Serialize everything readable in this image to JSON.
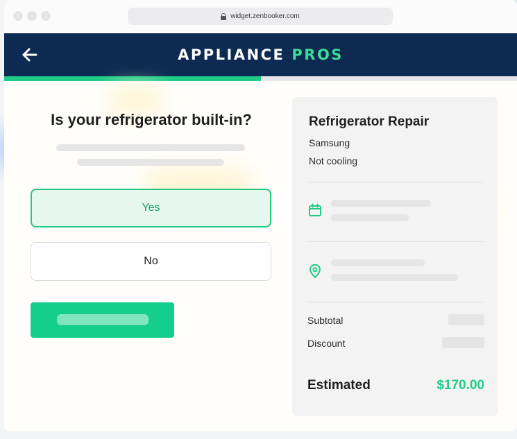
{
  "browser": {
    "url": "widget.zenbooker.com",
    "lock_icon": "lock-icon"
  },
  "header": {
    "back_icon": "arrow-left-icon",
    "brand_primary": "APPLIANCE",
    "brand_accent": "PROS",
    "background_color": "#0d2b52",
    "accent_color": "#3ddc97",
    "progress_fraction": 0.5
  },
  "question": {
    "title": "Is your refrigerator built-in?",
    "options": [
      {
        "label": "Yes",
        "selected": true
      },
      {
        "label": "No",
        "selected": false
      }
    ]
  },
  "summary": {
    "service_title": "Refrigerator Repair",
    "brand": "Samsung",
    "issue": "Not cooling",
    "date_icon": "calendar-icon",
    "location_icon": "map-pin-icon",
    "subtotal_label": "Subtotal",
    "discount_label": "Discount",
    "estimated_label": "Estimated",
    "estimated_value": "$170.00"
  },
  "colors": {
    "primary_green": "#14cf8b",
    "selected_bg": "#e6f8ee"
  }
}
